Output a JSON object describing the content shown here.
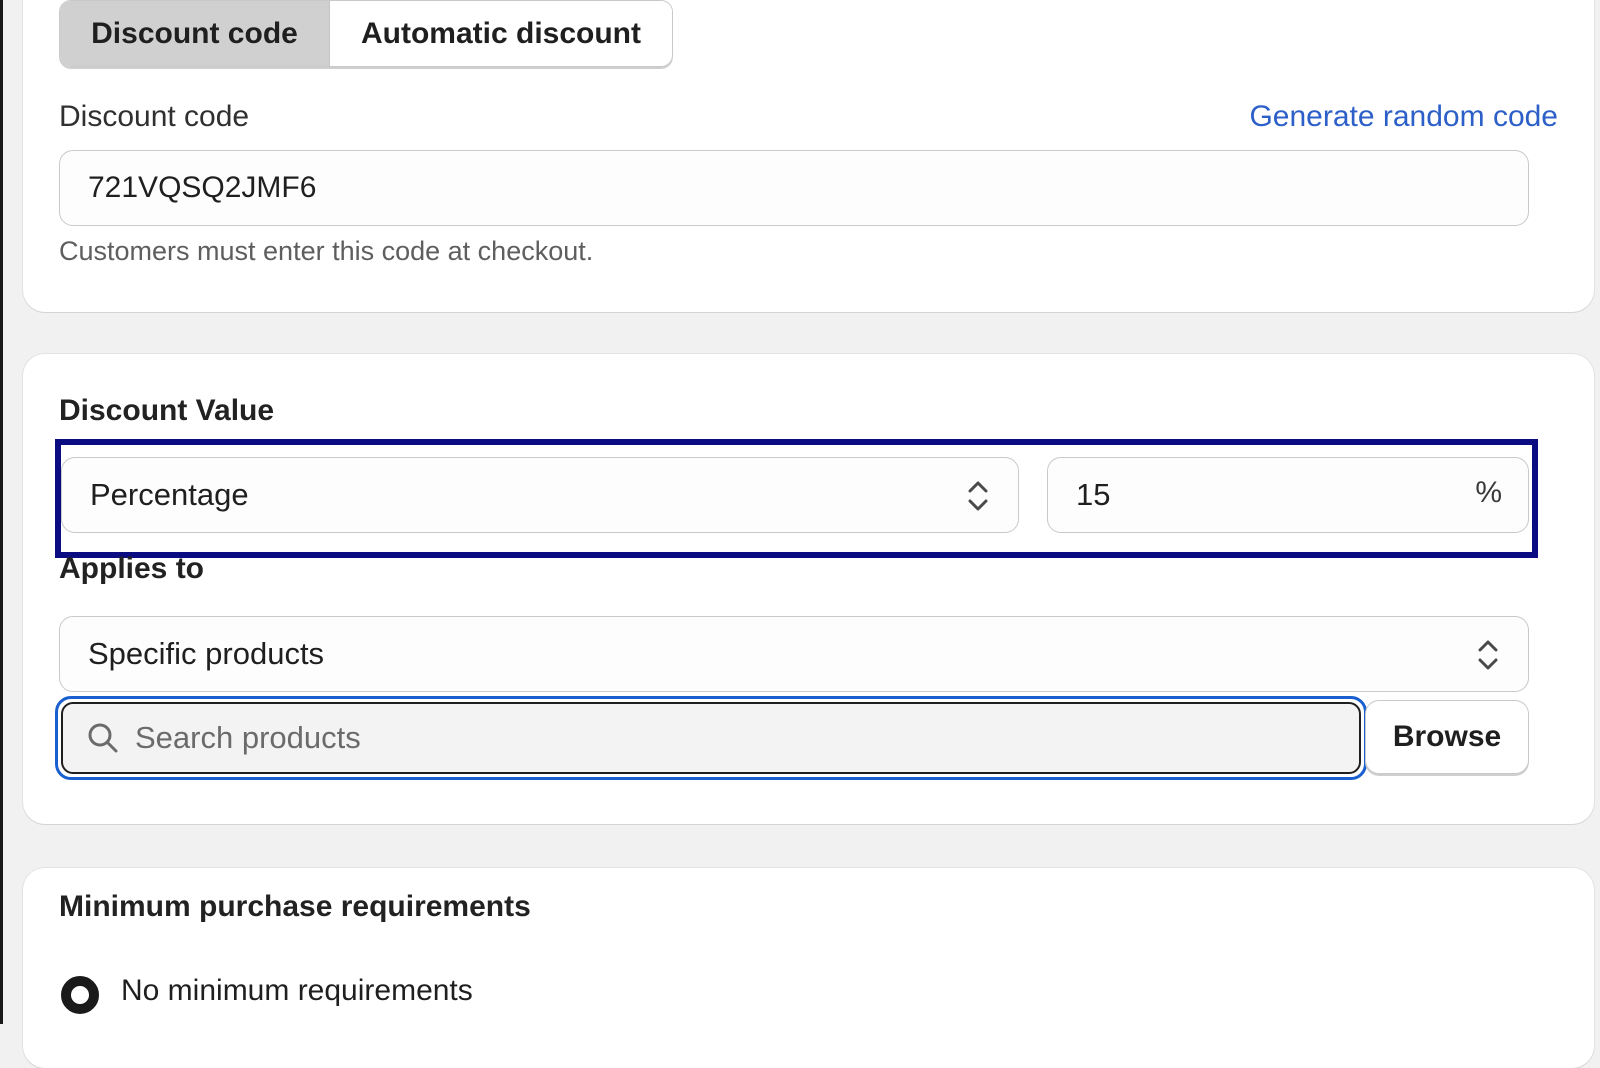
{
  "method_tabs": {
    "discount_code": "Discount code",
    "automatic_discount": "Automatic discount"
  },
  "discount_code_section": {
    "label": "Discount code",
    "generate_link": "Generate random code",
    "code_value": "721VQSQ2JMF6",
    "help_text": "Customers must enter this code at checkout."
  },
  "discount_value_section": {
    "heading": "Discount Value",
    "type_selected": "Percentage",
    "amount_value": "15",
    "amount_suffix": "%",
    "applies_to_label": "Applies to",
    "applies_to_selected": "Specific products",
    "search_placeholder": "Search products",
    "browse_label": "Browse"
  },
  "minimum_section": {
    "heading": "Minimum purchase requirements",
    "option_1": "No minimum requirements"
  },
  "icons": {
    "select_chevron": "chevron-up-down-icon",
    "search": "search-icon",
    "radio": "radio-selected-icon"
  },
  "colors": {
    "link": "#2c5fc8",
    "highlight_border": "#0b0b82",
    "focus_ring": "#1a5fd0",
    "page_bg": "#f1f1f1"
  }
}
